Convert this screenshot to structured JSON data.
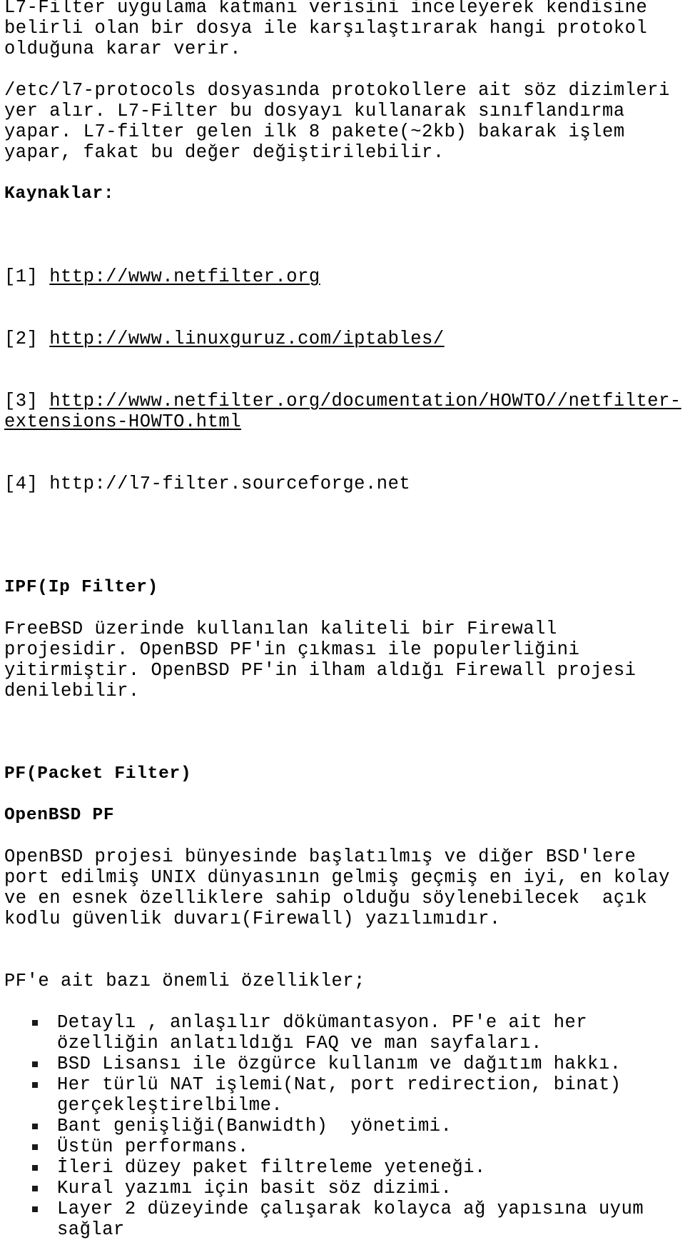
{
  "document": {
    "language": "tr",
    "text_color": "#000000",
    "background_color": "#ffffff",
    "paragraphs": {
      "intro_l7": "L7-Filter uygulama katmanı verisini inceleyerek kendisine belirli olan bir dosya ile karşılaştırarak hangi protokol olduğuna karar verir.",
      "l7_protocols": "/etc/l7-protocols dosyasında protokollere ait söz dizimleri yer alır. L7-Filter bu dosyayı kullanarak sınıflandırma yapar. L7-filter gelen ilk 8 pakete(~2kb) bakarak işlem yapar, fakat bu değer değiştirilebilir.",
      "ipf_body": "FreeBSD üzerinde kullanılan kaliteli bir Firewall projesidir. OpenBSD PF'in çıkması ile populerliğini yitirmiştir. OpenBSD PF'in ilham aldığı Firewall projesi denilebilir.",
      "pf_body": "OpenBSD projesi bünyesinde başlatılmış ve diğer BSD'lere port edilmiş UNIX dünyasının gelmiş geçmiş en iyi, en kolay ve en esnek özelliklere sahip olduğu söylenebilecek  açık kodlu güvenlik duvarı(Firewall) yazılımıdır.",
      "pf_features_intro": "PF'e ait bazı önemli özellikler;"
    },
    "headings": {
      "kaynaklar": "Kaynaklar:",
      "ipf": "IPF(Ip Filter)",
      "pf": "PF(Packet Filter)",
      "openbsd_pf": "OpenBSD PF"
    },
    "references": [
      {
        "marker": "[1] ",
        "url": "http://www.netfilter.org",
        "underlined": true
      },
      {
        "marker": "[2] ",
        "url": "http://www.linuxguruz.com/iptables/",
        "underlined": true
      },
      {
        "marker": "[3] ",
        "url": "http://www.netfilter.org/documentation/HOWTO//netfilter-extensions-HOWTO.html",
        "underlined": true
      },
      {
        "marker": "[4] ",
        "url": "http://l7-filter.sourceforge.net",
        "underlined": false
      }
    ],
    "pf_features": [
      "Detaylı , anlaşılır dökümantasyon. PF'e ait her özelliğin anlatıldığı FAQ ve man sayfaları.",
      "BSD Lisansı ile özgürce kullanım ve dağıtım hakkı.",
      "Her türlü NAT işlemi(Nat, port redirection, binat) gerçekleştirelbilme.",
      "Bant genişliği(Banwidth)  yönetimi.",
      "Üstün performans.",
      "İleri düzey paket filtreleme yeteneği.",
      "Kural yazımı için basit söz dizimi.",
      "Layer 2 düzeyinde çalışarak kolayca ağ yapısına uyum sağlar"
    ],
    "bullet_glyph": "filled-square"
  }
}
